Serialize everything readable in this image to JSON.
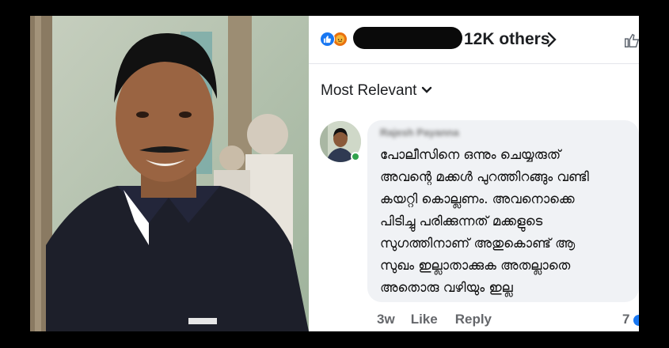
{
  "reactions": {
    "count_text": "12K others",
    "icons": [
      "like-icon",
      "angry-icon"
    ],
    "redacted": true
  },
  "sort": {
    "label": "Most Relevant"
  },
  "comment": {
    "author": "Rajesh Payanna",
    "text_lines": [
      "പോലീസിനെ ഒന്നും ചെയ്യരുത്",
      "അവന്റെ മക്കൾ പുറത്തിറങ്ങും വണ്ടി",
      "കയറ്റി കൊല്ലണം. അവനൊക്കെ",
      "പിടിച്ചു പരിക്കുന്നത് മക്കളുടെ",
      "സുഗത്തിനാണ് അതുകൊണ്ട് ആ",
      "സുഖം ഇല്ലാതാക്കുക അതല്ലാതെ",
      "അതൊരു വഴിയും ഇല്ല"
    ],
    "time": "3w",
    "like_label": "Like",
    "reply_label": "Reply",
    "reaction_count": "7"
  },
  "colors": {
    "facebook_blue": "#1877f2",
    "angry_orange": "#e9710f",
    "online_green": "#31a24c",
    "bubble_bg": "#f0f2f5",
    "meta_text": "#65676b"
  }
}
